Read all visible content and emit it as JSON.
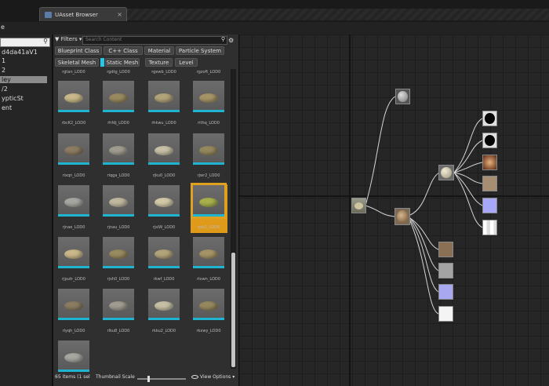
{
  "window": {
    "tab_title": "UAsset Browser",
    "tab_close": "×",
    "menu_letter": "e"
  },
  "tree": {
    "search_icon": "magnifier-icon",
    "items": [
      {
        "label": "d4da41aV1",
        "selected": false
      },
      {
        "label": "1",
        "selected": false
      },
      {
        "label": "2",
        "selected": false
      },
      {
        "label": "ley",
        "selected": true
      },
      {
        "label": "/2",
        "selected": false
      },
      {
        "label": "ypticSt",
        "selected": false
      },
      {
        "label": "ent",
        "selected": false
      }
    ]
  },
  "content": {
    "filters_label": "▼ Filters ▾",
    "search_placeholder": "Search Content",
    "filter_chips": [
      "Blueprint Class",
      "C++ Class",
      "Material",
      "Particle System",
      "Skeletal Mesh",
      "Static Mesh",
      "Texture",
      "Level"
    ],
    "active_chip": "Static Mesh",
    "top_labels": [
      "rgtan_LOD0",
      "rgdtg_LOD0",
      "rgewb_LOD0",
      "rgzoft_LOD0"
    ],
    "assets": [
      "rbcK2_LOD0",
      "rhfdj_LOD0",
      "rhkwu_LOD0",
      "rithq_LOD0",
      "rixqn_LOD0",
      "riqga_LOD0",
      "rjku0_LOD0",
      "rjwr2_LOD0",
      "rjnae_LOD0",
      "rjnau_LOD0",
      "rjsiW_LOD0",
      "rjxk1_LOD0",
      "rjputr_LOD0",
      "rjsh0_LOD0",
      "rkwf_LOD0",
      "rlown_LOD0",
      "rlyqh_LOD0",
      "rlku8_LOD0",
      "rkku2_LOD0",
      "rkxwy_LOD0",
      ""
    ],
    "selected_asset": "rjxk1_LOD0",
    "status_text": "65 items (1 sel",
    "thumbnail_scale_label": "Thumbnail Scale",
    "thumbnail_scale": 0.22,
    "view_options_label": "View Options ▾"
  },
  "graph": {
    "nodes": [
      {
        "id": "root",
        "kind": "mesh-thumbnail"
      },
      {
        "id": "grey-sphere-top",
        "kind": "sphere-grey"
      },
      {
        "id": "hub-mesh",
        "kind": "mesh-thumbnail"
      },
      {
        "id": "material",
        "kind": "sphere-cream"
      },
      {
        "id": "black-1",
        "kind": "sphere-black"
      },
      {
        "id": "black-2",
        "kind": "sphere-black"
      },
      {
        "id": "rock-tex",
        "kind": "texture-rock"
      },
      {
        "id": "tan-tex",
        "kind": "texture-tan"
      },
      {
        "id": "normal-tex",
        "kind": "texture-normal"
      },
      {
        "id": "white-tex",
        "kind": "texture-white"
      },
      {
        "id": "tex-a",
        "kind": "texture-rock"
      },
      {
        "id": "tex-b",
        "kind": "texture-grey"
      },
      {
        "id": "tex-c",
        "kind": "texture-normal"
      },
      {
        "id": "tex-d",
        "kind": "texture-white"
      }
    ]
  },
  "colors": {
    "accent": "#2ac6e6",
    "selection": "#e09a1a",
    "panel": "#2f2f2f",
    "graph_bg": "#262626"
  }
}
